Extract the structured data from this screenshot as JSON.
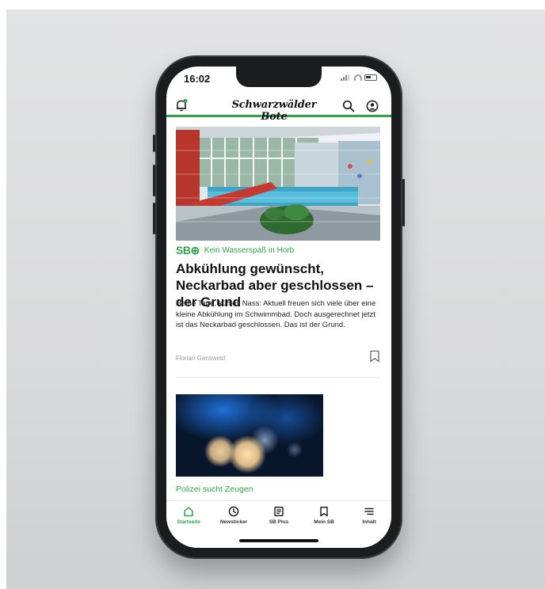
{
  "status": {
    "time": "16:02"
  },
  "header": {
    "logo": "Schwarzwälder Bote"
  },
  "article1": {
    "badge": "SB⊕",
    "kicker": "Kein Wasserspaß in Horb",
    "headline": "Abkühlung gewünscht, Neckarbad aber geschlossen – der Grund",
    "teaser": "Heiße Tage, kühles Nass: Aktuell freuen sich viele über eine kleine Abkühlung im Schwimmbad. Doch ausgerechnet jetzt ist das Neckarbad geschlossen. Das ist der Grund.",
    "author": "Florian Ganswind"
  },
  "article2": {
    "kicker": "Polizei sucht Zeugen"
  },
  "tabbar": {
    "items": [
      {
        "label": "Startseite",
        "icon": "home-icon"
      },
      {
        "label": "Newsticker",
        "icon": "clock-icon"
      },
      {
        "label": "SB Plus",
        "icon": "newspaper-icon"
      },
      {
        "label": "Mein SB",
        "icon": "bookmark-icon"
      },
      {
        "label": "Inhalt",
        "icon": "menu-icon"
      }
    ]
  },
  "colors": {
    "accent": "#2da64a",
    "text": "#111111"
  }
}
